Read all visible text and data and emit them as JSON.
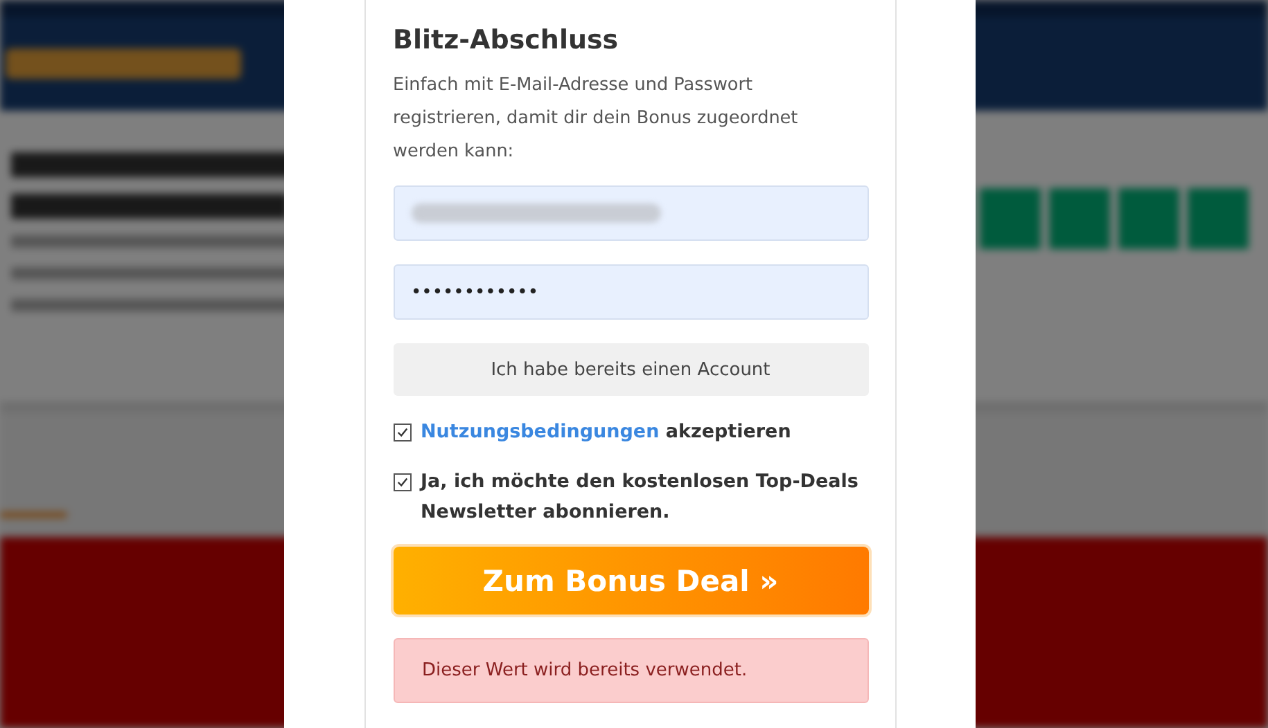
{
  "dialog": {
    "title": "Blitz-Abschluss",
    "description": "Einfach mit E-Mail-Adresse und Passwort registrieren, damit dir dein Bonus zugeordnet werden kann:",
    "email_field": {
      "redacted": true
    },
    "password_field": {
      "value": "••••••••••••"
    },
    "account_button": "Ich habe bereits einen Account",
    "checkboxes": [
      {
        "link": "Nutzungsbedingungen",
        "text": "akzeptieren",
        "checked": true
      },
      {
        "text": "Ja, ich möchte den kostenlosen Top-Deals Newsletter abonnieren.",
        "checked": true
      }
    ],
    "submit_button": "Zum Bonus Deal »",
    "error_message": "Dieser Wert wird bereits verwendet."
  }
}
